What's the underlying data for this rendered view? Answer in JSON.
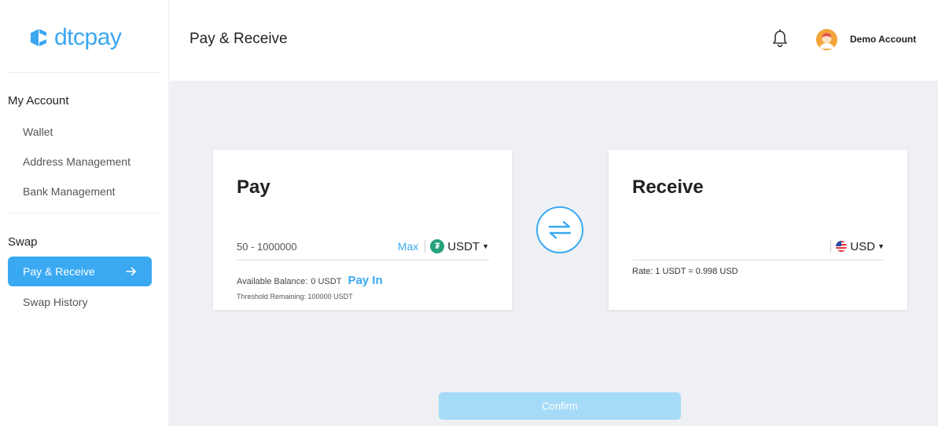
{
  "brand": {
    "name": "dtcpay",
    "accent": "#3aa9f2"
  },
  "sidebar": {
    "sections": [
      {
        "title": "My Account",
        "items": [
          "Wallet",
          "Address Management",
          "Bank Management"
        ]
      },
      {
        "title": "Swap",
        "items": [
          "Pay & Receive",
          "Swap History"
        ]
      }
    ],
    "active_item": "Pay & Receive"
  },
  "header": {
    "title": "Pay & Receive",
    "icons": {
      "notifications": "bell-icon"
    },
    "account_name": "Demo Account"
  },
  "pay": {
    "title": "Pay",
    "placeholder": "50 - 1000000",
    "max_label": "Max",
    "currency": "USDT",
    "currency_icon": "tether-icon",
    "balance_label": "Available Balance:",
    "balance_value": "0 USDT",
    "pay_in_label": "Pay In",
    "threshold_text": "Threshold Remaining: 100000 USDT"
  },
  "receive": {
    "title": "Receive",
    "currency": "USD",
    "currency_icon": "us-flag-icon",
    "rate_text": "Rate:  1 USDT = 0.998 USD"
  },
  "confirm_label": "Confirm"
}
